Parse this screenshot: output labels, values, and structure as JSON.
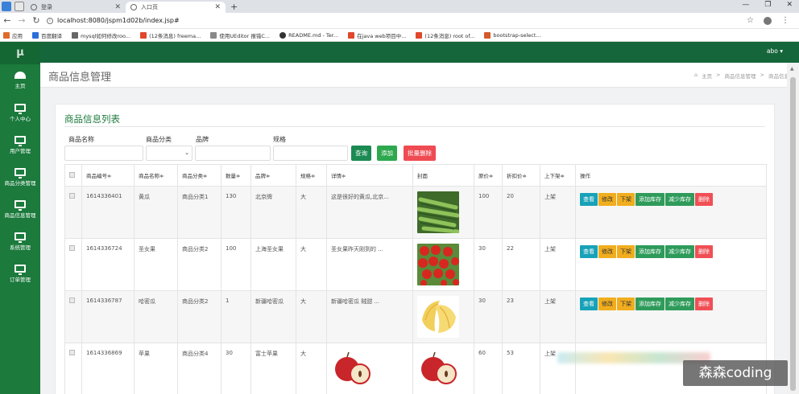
{
  "browser": {
    "tabs": [
      {
        "title": "登录",
        "active": false
      },
      {
        "title": "入口页",
        "active": true
      }
    ],
    "new_tab": "+",
    "url": "localhost:8080/jspm1d02b/index.jsp#",
    "bookmarks": [
      {
        "label": "应用",
        "color": "#e06a2b"
      },
      {
        "label": "百度翻译",
        "color": "#2b6fd9"
      },
      {
        "label": "mysql如何修改roo...",
        "color": "#666666"
      },
      {
        "label": "(12条消息) freema...",
        "color": "#e0472b"
      },
      {
        "label": "使用UEditor 报错C...",
        "color": "#888888"
      },
      {
        "label": "README.md - Ter...",
        "color": "#333333"
      },
      {
        "label": "在java web项目中...",
        "color": "#e0472b"
      },
      {
        "label": "(12条消息) root of...",
        "color": "#e0472b"
      },
      {
        "label": "bootstrap-select...",
        "color": "#d45a2b"
      }
    ]
  },
  "sidebar": {
    "logo": "μ",
    "items": [
      {
        "label": "主页",
        "icon": "gauge-icon"
      },
      {
        "label": "个人中心",
        "icon": "monitor-icon"
      },
      {
        "label": "用户管理",
        "icon": "monitor-icon"
      },
      {
        "label": "商品分类管理",
        "icon": "monitor-icon"
      },
      {
        "label": "商品信息管理",
        "icon": "monitor-icon"
      },
      {
        "label": "系统管理",
        "icon": "monitor-icon"
      },
      {
        "label": "订单管理",
        "icon": "monitor-icon"
      }
    ]
  },
  "topnav": {
    "user": "abo ▾"
  },
  "header": {
    "title": "商品信息管理",
    "breadcrumb": [
      "主页",
      ">",
      "商品信息管理",
      ">",
      "商品信息"
    ]
  },
  "panel": {
    "title": "商品信息列表",
    "filters": {
      "name_label": "商品名称",
      "category_label": "商品分类",
      "brand_label": "品牌",
      "spec_label": "规格"
    },
    "buttons": {
      "search": "查询",
      "add": "添加",
      "batch_delete": "批量删除"
    }
  },
  "table": {
    "headers": [
      "商品编号≑",
      "商品名称≑",
      "商品分类≑",
      "数量≑",
      "品牌≑",
      "规格≑",
      "详情≑",
      "封面",
      "原价≑",
      "折扣价≑",
      "上下架≑",
      "操作"
    ],
    "rows": [
      {
        "id": "1614336401",
        "name": "黄瓜",
        "category": "商品分类1",
        "qty": "130",
        "brand": "北京牌",
        "spec": "大",
        "detail": "这是很好的黄瓜,北京...",
        "cover": "cucumber",
        "price": "100",
        "discount": "20",
        "shelf": "上架",
        "detail_img": ""
      },
      {
        "id": "1614336724",
        "name": "圣女果",
        "category": "商品分类2",
        "qty": "100",
        "brand": "上海圣女果",
        "spec": "大",
        "detail": "圣女果昨天刚到的 ...",
        "cover": "tomato",
        "price": "30",
        "discount": "22",
        "shelf": "上架",
        "detail_img": ""
      },
      {
        "id": "1614336787",
        "name": "哈密瓜",
        "category": "商品分类2",
        "qty": "1",
        "brand": "新疆哈密瓜",
        "spec": "大",
        "detail": "新疆哈密瓜 贼甜 ...",
        "cover": "melon",
        "price": "30",
        "discount": "23",
        "shelf": "上架",
        "detail_img": ""
      },
      {
        "id": "1614336869",
        "name": "苹果",
        "category": "商品分类4",
        "qty": "30",
        "brand": "富士苹果",
        "spec": "大",
        "detail": "",
        "cover": "apple",
        "price": "60",
        "discount": "53",
        "shelf": "上架",
        "detail_img": "apple"
      }
    ],
    "actions": {
      "view": "查看",
      "edit": "修改",
      "off_shelf": "下架",
      "add_stock": "添加库存",
      "reduce_stock": "减少库存",
      "delete": "删除"
    }
  },
  "watermark": "森森coding"
}
